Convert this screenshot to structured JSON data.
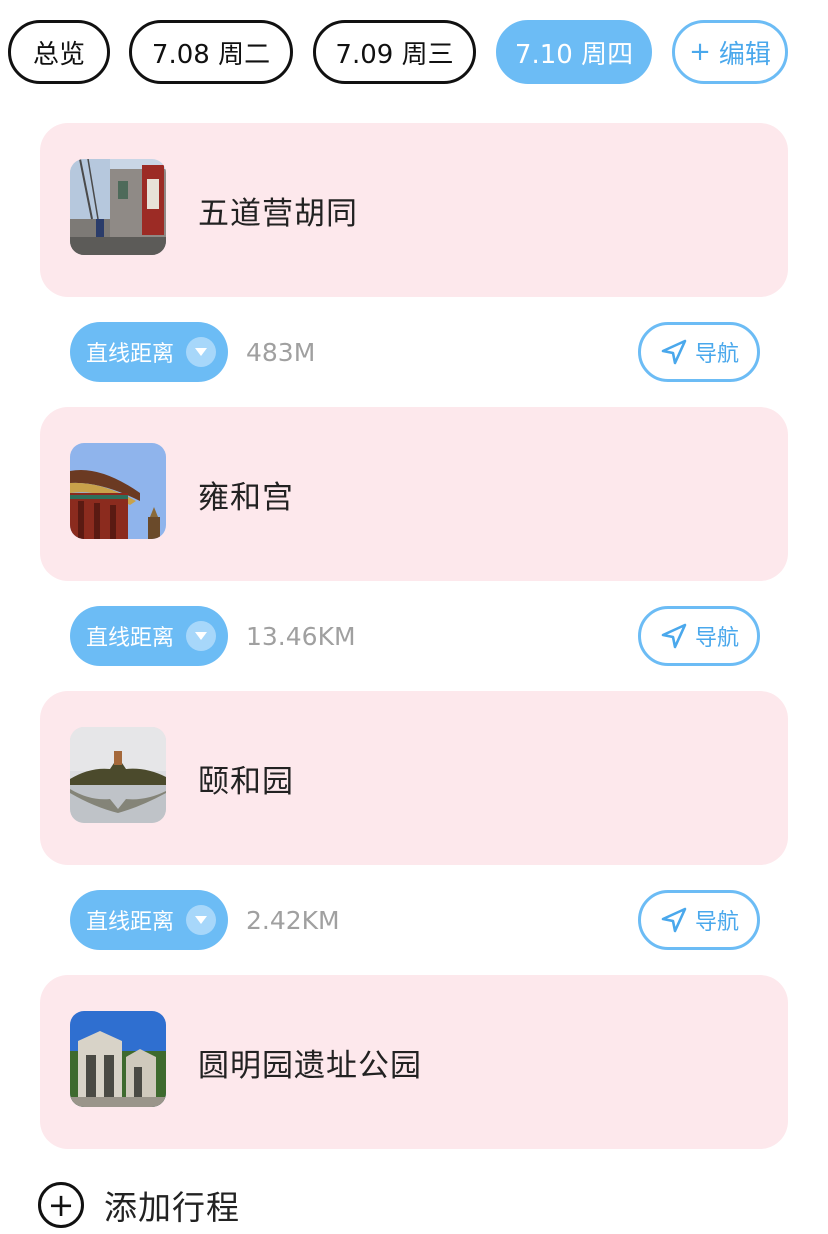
{
  "tabs": [
    {
      "label": "总览",
      "active": false
    },
    {
      "label": "7.08 周二",
      "active": false
    },
    {
      "label": "7.09 周三",
      "active": false
    },
    {
      "label": "7.10 周四",
      "active": true
    }
  ],
  "edit_tab": {
    "icon": "plus-icon",
    "label": "编辑"
  },
  "stops": [
    {
      "name": "五道营胡同",
      "thumb_icon": "hutong-photo"
    },
    {
      "name": "雍和宫",
      "thumb_icon": "temple-photo"
    },
    {
      "name": "颐和园",
      "thumb_icon": "summer-palace-photo"
    },
    {
      "name": "圆明园遗址公园",
      "thumb_icon": "ruins-photo"
    }
  ],
  "segments": [
    {
      "mode_label": "直线距离",
      "distance": "483M",
      "nav_label": "导航"
    },
    {
      "mode_label": "直线距离",
      "distance": "13.46KM",
      "nav_label": "导航"
    },
    {
      "mode_label": "直线距离",
      "distance": "2.42KM",
      "nav_label": "导航"
    }
  ],
  "add_itinerary": {
    "label": "添加行程",
    "icon": "plus-circle-icon"
  },
  "colors": {
    "accent": "#6cbcf5",
    "card_bg": "#fde8ec",
    "muted_text": "#a0a0a0"
  }
}
